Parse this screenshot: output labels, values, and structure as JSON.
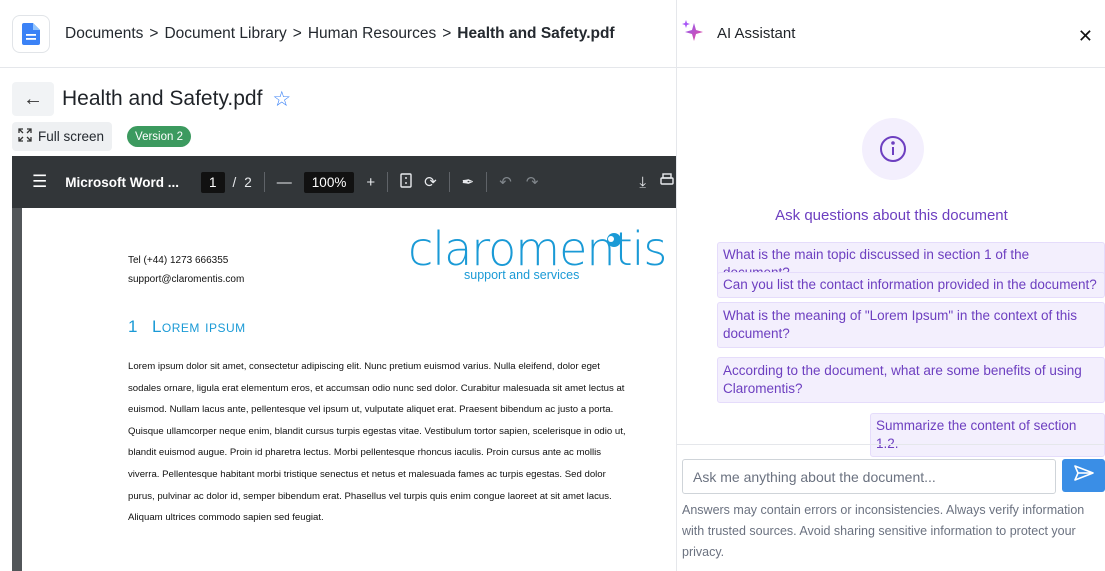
{
  "breadcrumb": {
    "items": [
      "Documents",
      "Document Library",
      "Human Resources"
    ],
    "current": "Health and Safety.pdf",
    "separator": ">"
  },
  "document": {
    "title": "Health and Safety.pdf",
    "fullscreen_label": "Full screen",
    "version_label": "Version 2"
  },
  "viewer": {
    "file_name": "Microsoft Word ...",
    "current_page": "1",
    "page_sep": "/",
    "total_pages": "2",
    "zoom": "100%"
  },
  "page_content": {
    "tel": "Tel (+44) 1273 666355",
    "email": "support@claromentis.com",
    "logo_text": "claromentis",
    "logo_sub": "support and services",
    "section_number": "1",
    "section_title": "Lorem ipsum",
    "body": "Lorem ipsum dolor sit amet, consectetur adipiscing elit. Nunc pretium euismod varius. Nulla eleifend, dolor eget sodales ornare, ligula erat elementum eros, et accumsan odio nunc sed dolor. Curabitur malesuada sit amet lectus at euismod. Nullam lacus ante, pellentesque vel ipsum ut, vulputate aliquet erat. Praesent bibendum ac justo a porta. Quisque ullamcorper neque enim, blandit cursus turpis egestas vitae. Vestibulum tortor sapien, scelerisque in odio ut, blandit euismod augue. Proin id pharetra lectus. Morbi pellentesque rhoncus iaculis. Proin cursus ante ac mollis viverra. Pellentesque habitant morbi tristique senectus et netus et malesuada fames ac turpis egestas. Sed dolor purus, pulvinar ac dolor id, semper bibendum erat. Phasellus vel turpis quis enim congue laoreet at sit amet lacus. Aliquam ultrices commodo sapien sed feugiat."
  },
  "assistant": {
    "title": "AI Assistant",
    "heading": "Ask questions about this document",
    "suggestions": [
      "What is the main topic discussed in section 1 of the document?",
      "Can you list the contact information provided in the document?",
      "What is the meaning of \"Lorem Ipsum\" in the context of this document?",
      "According to the document, what are some benefits of using Claromentis?",
      "Summarize the content of section 1.2."
    ],
    "input_placeholder": "Ask me anything about the document...",
    "disclaimer": "Answers may contain errors or inconsistencies. Always verify information with trusted sources. Avoid sharing sensitive information to protect your privacy."
  },
  "colors": {
    "accent_purple": "#6d3fc0",
    "suggestion_bg": "#f3effd",
    "send_button": "#3a8ee6",
    "version_badge": "#3c9a5f",
    "star": "#3b82f6",
    "brand_blue": "#1a9ad6",
    "viewer_toolbar": "#323639"
  },
  "icons": {
    "app": "document-icon",
    "back": "arrow-left-icon",
    "favorite": "star-outline-icon",
    "fullscreen": "expand-icon",
    "assistant": "sparkle-icon",
    "close": "close-icon",
    "info": "info-circle-icon",
    "send": "send-icon"
  }
}
